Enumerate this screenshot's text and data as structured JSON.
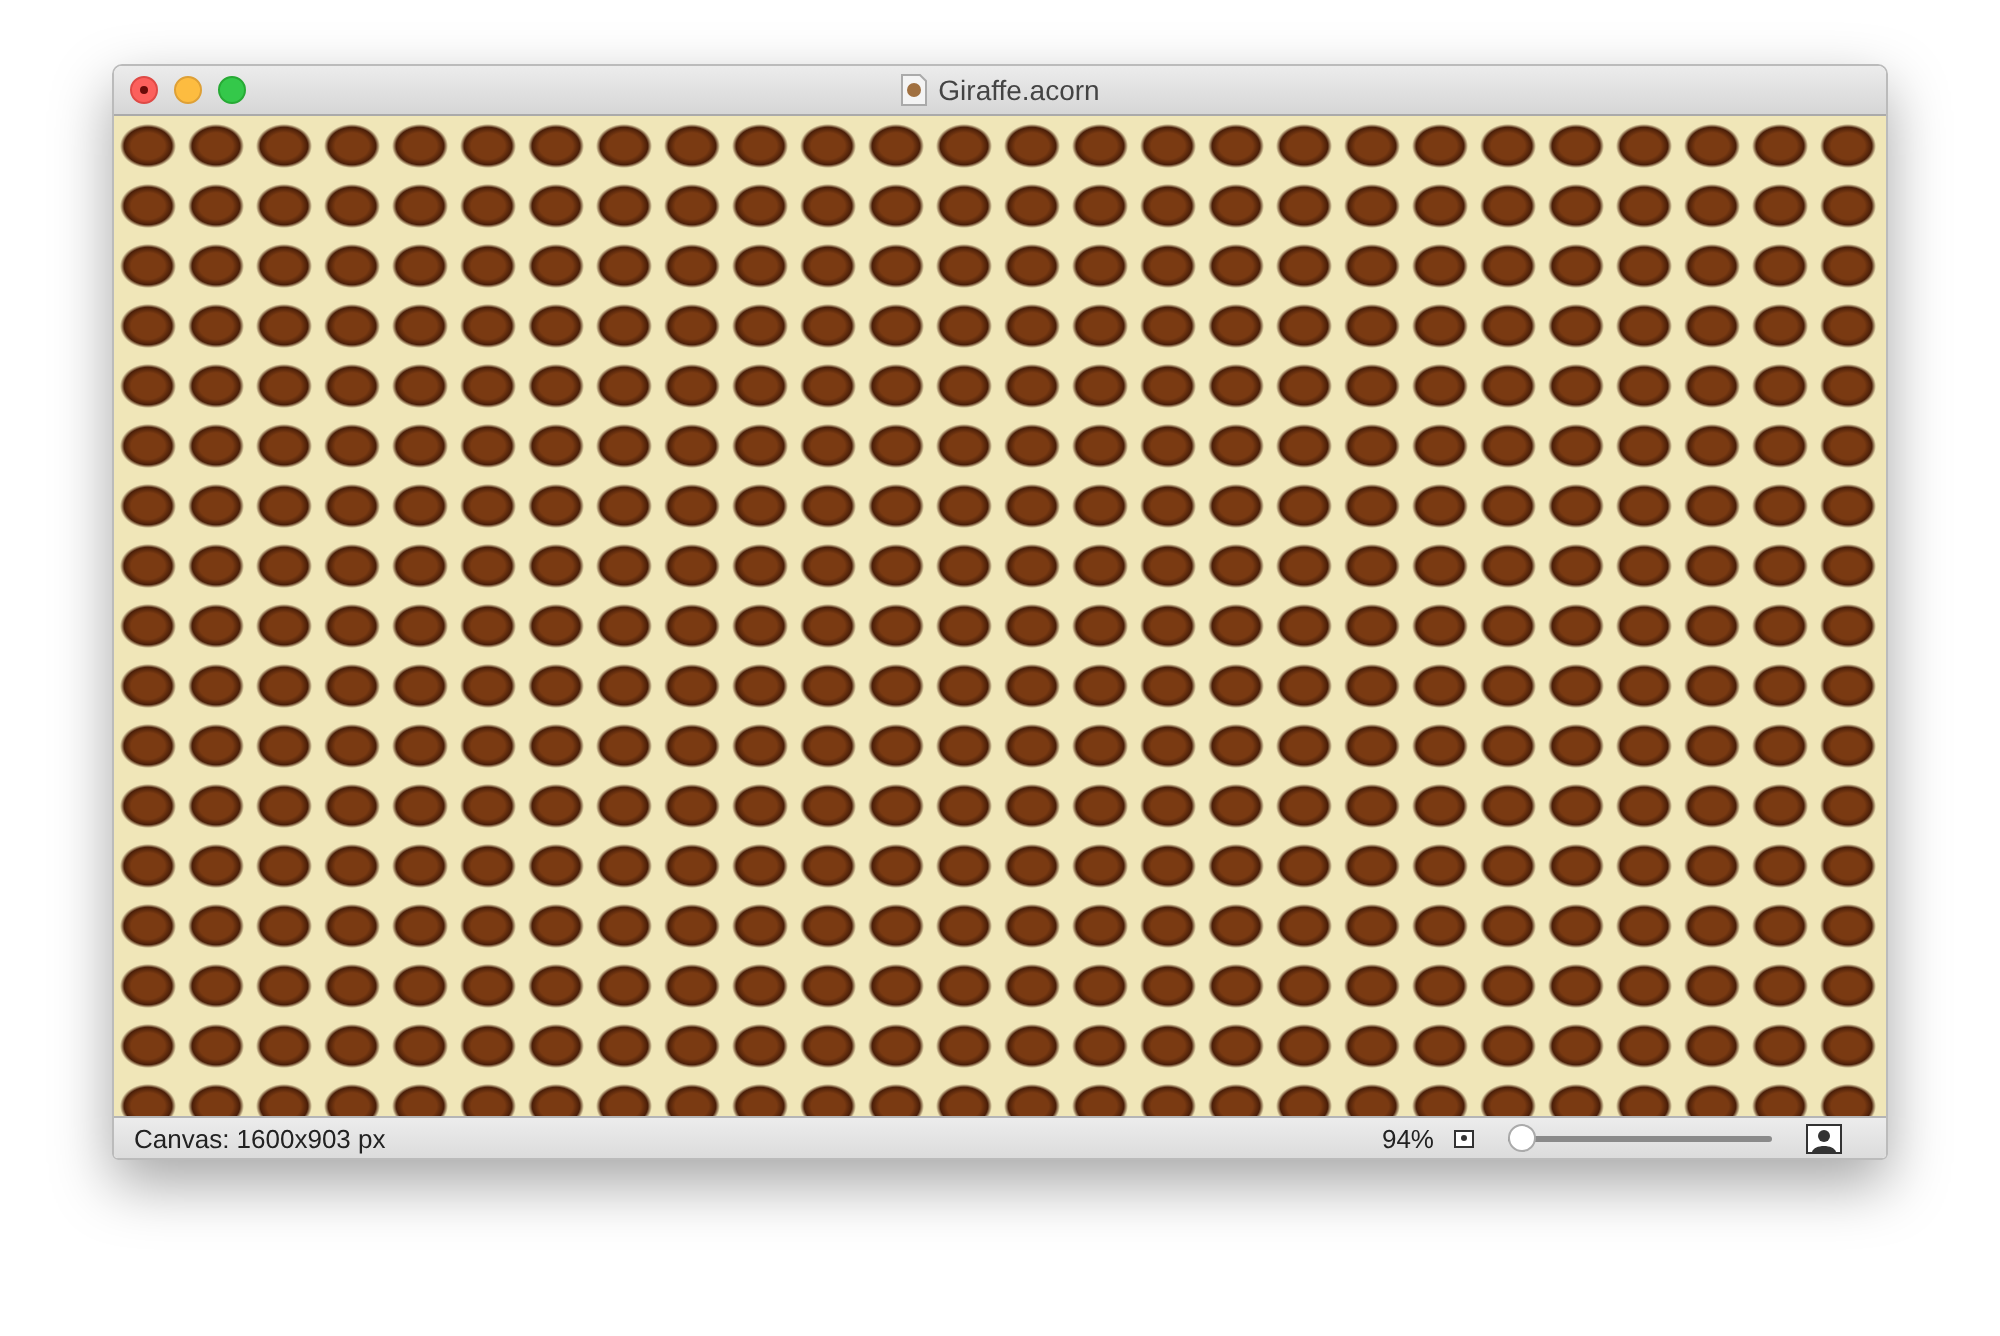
{
  "window": {
    "title": "Giraffe.acorn"
  },
  "status_bar": {
    "canvas_info": "Canvas: 1600x903 px",
    "zoom": "94%",
    "zoom_slider": {
      "level": 0.05
    }
  }
}
